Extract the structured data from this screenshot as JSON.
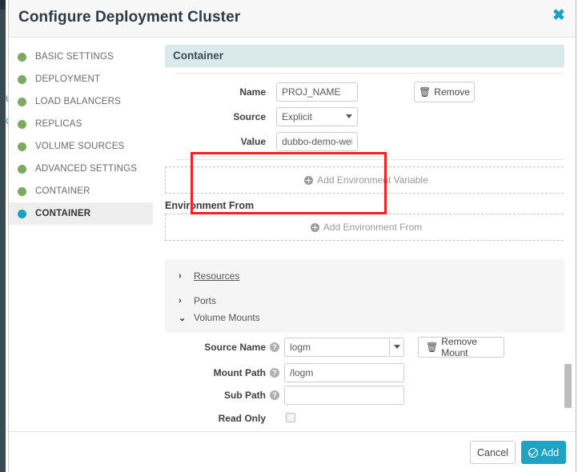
{
  "window": {
    "title": "Configure Deployment Cluster",
    "close_icon": "close-icon",
    "close_glyph": "✖"
  },
  "background_page": {
    "ghost_fragment_1": "U",
    "ghost_fragment_2": "C"
  },
  "sidebar": {
    "items": [
      {
        "label": "BASIC SETTINGS",
        "state": "complete",
        "dot_color": "#7aab5e"
      },
      {
        "label": "DEPLOYMENT",
        "state": "complete",
        "dot_color": "#7aab5e"
      },
      {
        "label": "LOAD BALANCERS",
        "state": "complete",
        "dot_color": "#7aab5e"
      },
      {
        "label": "REPLICAS",
        "state": "complete",
        "dot_color": "#7aab5e"
      },
      {
        "label": "VOLUME SOURCES",
        "state": "complete",
        "dot_color": "#7aab5e"
      },
      {
        "label": "ADVANCED SETTINGS",
        "state": "complete",
        "dot_color": "#7aab5e"
      },
      {
        "label": "CONTAINER",
        "state": "complete",
        "dot_color": "#7aab5e"
      },
      {
        "label": "CONTAINER",
        "state": "active",
        "dot_color": "#18a2c4"
      }
    ]
  },
  "panel": {
    "header": "Container",
    "header_bg": "#d9e9ec",
    "env_var": {
      "name_label": "Name",
      "name_value": "PROJ_NAME",
      "source_label": "Source",
      "source_value": "Explicit",
      "value_label": "Value",
      "value_value": "dubbo-demo-wel",
      "remove_label": "Remove",
      "remove_icon": "trash-icon",
      "trash_glyph": "🗑"
    },
    "add_env_var_label": "Add Environment Variable",
    "environment_from_heading": "Environment From",
    "add_env_from_label": "Add Environment From",
    "accordion": [
      {
        "label": "Resources",
        "expanded": false,
        "chevron": "›",
        "underlined": true
      },
      {
        "label": "Ports",
        "expanded": false,
        "chevron": "›",
        "underlined": false
      },
      {
        "label": "Volume Mounts",
        "expanded": true,
        "chevron": "⌄",
        "underlined": false
      }
    ],
    "volume_mount": {
      "source_name_label": "Source Name",
      "source_name_value": "logm",
      "mount_path_label": "Mount Path",
      "mount_path_value": "/logm",
      "sub_path_label": "Sub Path",
      "sub_path_value": "",
      "read_only_label": "Read Only",
      "read_only_checked": false,
      "remove_mount_label": "Remove Mount",
      "remove_mount_icon": "trash-icon",
      "trash_glyph": "🗑",
      "help_glyph": "?",
      "highlight_color": "#f22222"
    }
  },
  "footer": {
    "cancel_label": "Cancel",
    "add_label": "Add",
    "add_icon": "check-circle-icon",
    "add_color": "#1fa2c4"
  }
}
